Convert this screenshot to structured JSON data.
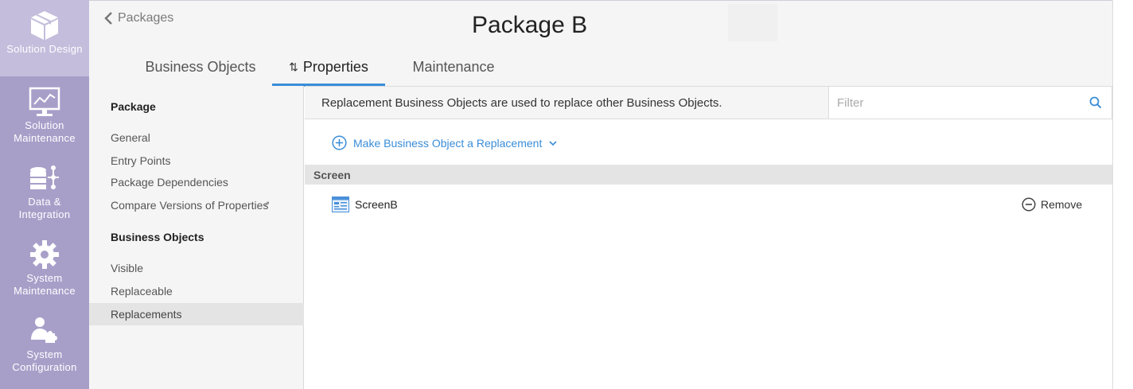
{
  "leftnav": {
    "items": [
      {
        "label": "Solution Design",
        "icon": "box-icon",
        "active": true
      },
      {
        "label": "Solution Maintenance",
        "icon": "monitor-chart-icon",
        "active": false
      },
      {
        "label": "Data & Integration",
        "icon": "database-icon",
        "active": false
      },
      {
        "label": "System Maintenance",
        "icon": "gear-icon",
        "active": false
      },
      {
        "label": "System Configuration",
        "icon": "user-puzzle-icon",
        "active": false
      }
    ]
  },
  "header": {
    "back_label": "Packages",
    "title": "Package B",
    "tabs": [
      {
        "label": "Business Objects"
      },
      {
        "label": "Properties"
      },
      {
        "label": "Maintenance"
      }
    ]
  },
  "sidemenu": {
    "package_heading": "Package",
    "package_items": [
      "General",
      "Entry Points",
      "Package Dependencies",
      "Compare Versions of Properties"
    ],
    "bo_heading": "Business Objects",
    "bo_items": [
      "Visible",
      "Replaceable",
      "Replacements"
    ],
    "selected": "Replacements"
  },
  "content": {
    "info_text": "Replacement Business Objects are used to replace other Business Objects.",
    "filter_placeholder": "Filter",
    "make_replacement_label": "Make Business Object a Replacement",
    "group_label": "Screen",
    "rows": [
      {
        "label": "ScreenB",
        "action": "Remove"
      }
    ]
  },
  "colors": {
    "nav_bg": "#a89fc9",
    "nav_active_bg": "#c4bddc",
    "accent": "#3a8dd8"
  }
}
